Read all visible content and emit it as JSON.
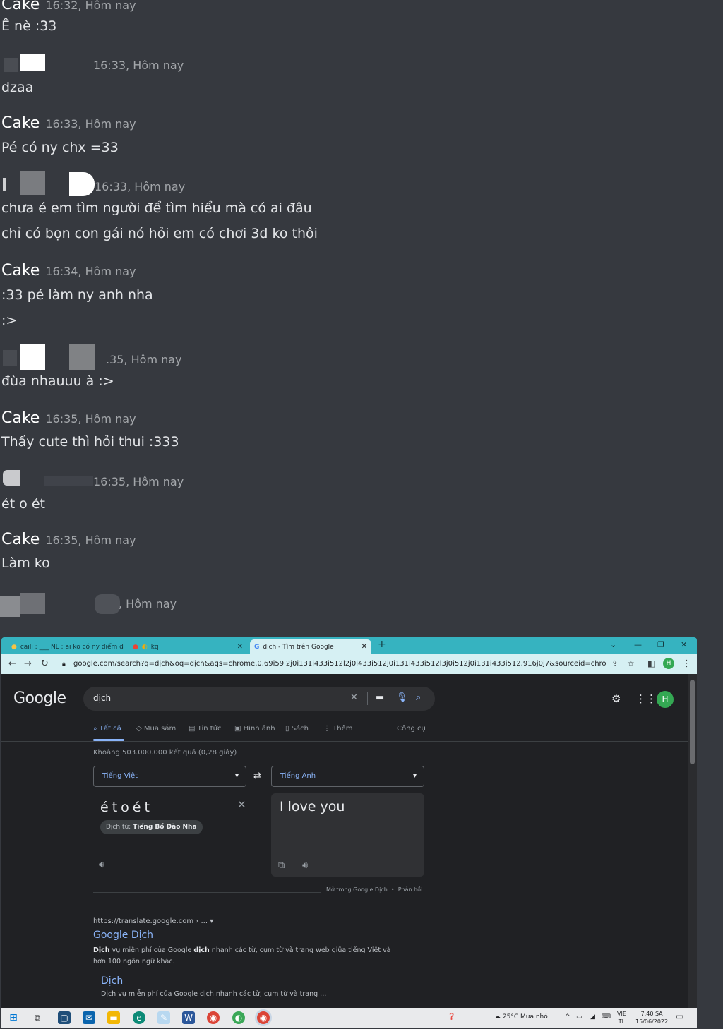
{
  "chat": {
    "messages": [
      {
        "author": "Cake",
        "time": "16:32, Hôm nay",
        "lines": [
          "Ê nè :33"
        ]
      },
      {
        "author": "",
        "time": "16:33, Hôm nay",
        "lines": [
          "dzaa"
        ]
      },
      {
        "author": "Cake",
        "time": "16:33, Hôm nay",
        "lines": [
          "Pé có ny chx =33"
        ]
      },
      {
        "author": "",
        "time": "16:33, Hôm nay",
        "lines": [
          "chưa é em tìm người để tìm hiểu mà có ai đâu",
          "chỉ có bọn con gái nó hỏi em có chơi 3d ko thôi"
        ]
      },
      {
        "author": "Cake",
        "time": "16:34, Hôm nay",
        "lines": [
          ":33 pé làm ny anh nha",
          ":>"
        ]
      },
      {
        "author": "",
        "time": ".35, Hôm nay",
        "lines": [
          "đùa nhauuu à :>"
        ]
      },
      {
        "author": "Cake",
        "time": "16:35, Hôm nay",
        "lines": [
          "Thấy cute thì hỏi thui :333"
        ]
      },
      {
        "author": "",
        "time": "16:35, Hôm nay",
        "lines": [
          "ét o ét"
        ]
      },
      {
        "author": "Cake",
        "time": "16:35, Hôm nay",
        "lines": [
          "Làm ko"
        ]
      },
      {
        "author": "",
        "time": ", Hôm nay",
        "lines": []
      }
    ]
  },
  "browser": {
    "tabs": [
      {
        "title": "caili : ___ NL : ai ko có ny điểm d"
      },
      {
        "title": "kq"
      },
      {
        "title": "dịch - Tìm trên Google"
      }
    ],
    "new_tab": "+",
    "url": "google.com/search?q=dịch&oq=dịch&aqs=chrome.0.69i59l2j0i131i433i512l2j0i433i512j0i131i433i512l3j0i512j0i131i433i512.916j0j7&sourceid=chrome&ie=UTF-8",
    "profile_initial": "H",
    "google": {
      "logo": "Google",
      "query": "dịch",
      "tabs": [
        "Tất cả",
        "Mua sắm",
        "Tin tức",
        "Hình ảnh",
        "Sách",
        "Thêm"
      ],
      "tools": "Công cụ",
      "stats": "Khoảng 503.000.000 kết quả (0,28 giây)",
      "translate": {
        "source_lang": "Tiếng Việt",
        "target_lang": "Tiếng Anh",
        "source_text": "étoét",
        "detected_prefix": "Dịch từ:",
        "detected_lang": "Tiếng Bồ Đào Nha",
        "target_text": "I love you",
        "open_link": "Mở trong Google Dịch",
        "separator": "•",
        "feedback": "Phản hồi"
      },
      "result": {
        "url": "https://translate.google.com › ...",
        "title": "Google Dịch",
        "snippet_a": "Dịch",
        "snippet_b": " vụ miễn phí của Google ",
        "snippet_c": "dịch",
        "snippet_d": " nhanh các từ, cụm từ và trang web giữa tiếng Việt và hơn 100 ngôn ngữ khác.",
        "sub_title": "Dịch",
        "sub_snippet": "Dịch vụ miễn phí của Google dịch nhanh các từ, cụm từ và trang ..."
      }
    },
    "taskbar": {
      "weather": "25°C  Mưa nhỏ",
      "lang": "VIE",
      "lang2": "TL",
      "time": "7:40 SA",
      "date": "15/06/2022"
    }
  }
}
